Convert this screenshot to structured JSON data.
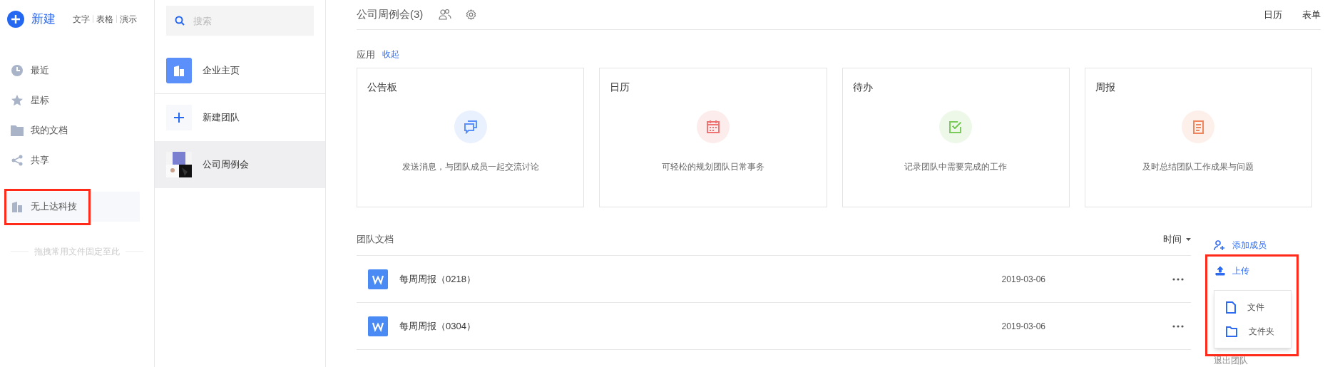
{
  "new_menu": {
    "label": "新建",
    "types": [
      "文字",
      "表格",
      "演示"
    ]
  },
  "nav": [
    {
      "kind": "clock",
      "label": "最近"
    },
    {
      "kind": "star",
      "label": "星标"
    },
    {
      "kind": "folder",
      "label": "我的文档"
    },
    {
      "kind": "share",
      "label": "共享"
    }
  ],
  "org": {
    "label": "无上达科技",
    "highlighted": true
  },
  "pin_hint": "拖拽常用文件固定至此",
  "teams": {
    "search_placeholder": "搜索",
    "items": [
      {
        "kind": "org",
        "label": "企业主页",
        "selected": false
      },
      {
        "kind": "new",
        "label": "新建团队",
        "selected": false
      },
      {
        "kind": "team",
        "label": "公司周例会",
        "selected": true
      }
    ]
  },
  "header": {
    "title": "公司周例会(3)",
    "views": [
      "日历",
      "表单"
    ]
  },
  "apps": {
    "label": "应用",
    "collapse": "收起",
    "cards": [
      {
        "kind": "chat",
        "title": "公告板",
        "desc": "发送消息，与团队成员一起交流讨论",
        "color": "#5b8ff9"
      },
      {
        "kind": "calendar",
        "title": "日历",
        "desc": "可轻松的规划团队日常事务",
        "color": "#f07474"
      },
      {
        "kind": "check",
        "title": "待办",
        "desc": "记录团队中需要完成的工作",
        "color": "#7acb5a"
      },
      {
        "kind": "report",
        "title": "周报",
        "desc": "及时总结团队工作成果与问题",
        "color": "#f0845a"
      }
    ]
  },
  "docs": {
    "label": "团队文档",
    "sort": "时间",
    "rows": [
      {
        "name": "每周周报（0218）",
        "date": "2019-03-06"
      },
      {
        "name": "每周周报（0304）",
        "date": "2019-03-06"
      }
    ]
  },
  "actions": {
    "add_member": "添加成员",
    "upload": "上传",
    "upload_highlighted": true,
    "upload_menu": [
      {
        "kind": "file",
        "label": "文件"
      },
      {
        "kind": "folder",
        "label": "文件夹"
      }
    ],
    "leave": "退出团队"
  }
}
